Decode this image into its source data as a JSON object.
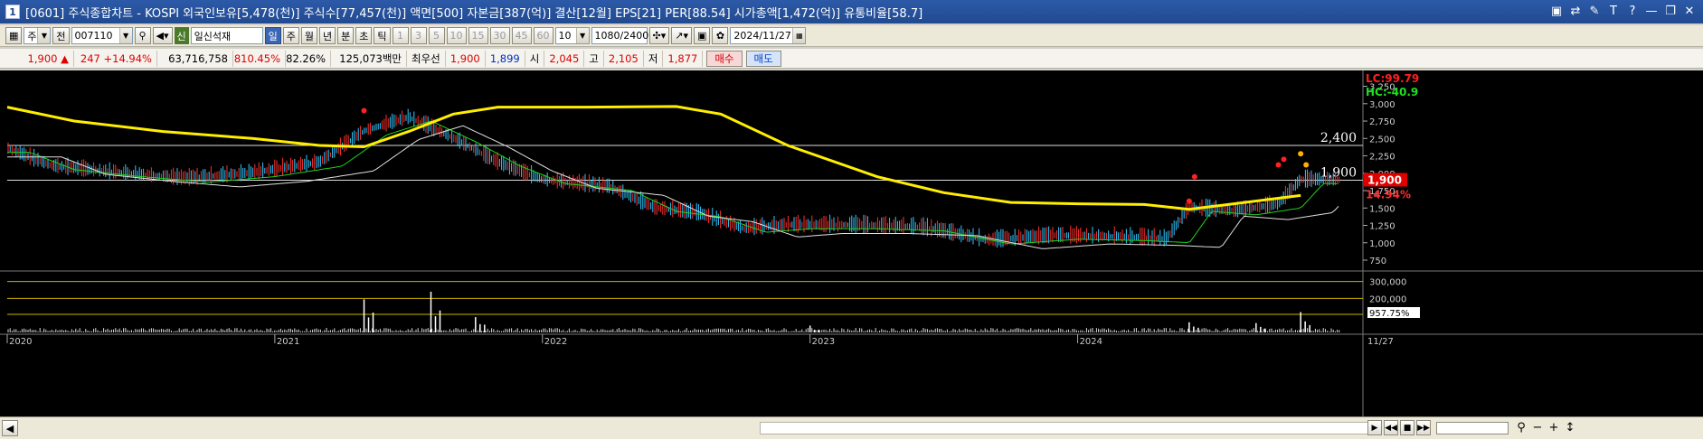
{
  "window": {
    "number": "1",
    "title": "[0601] 주식종합차트 - KOSPI 외국인보유[5,478(천)] 주식수[77,457(천)] 액면[500] 자본금[387(억)] 결산[12월] EPS[21] PER[88.54] 시가총액[1,472(억)] 유통비율[58.7]",
    "buttons": [
      "▣",
      "⇄",
      "✎",
      "T",
      "?",
      "—",
      "❐",
      "✕"
    ]
  },
  "toolbar": {
    "market_select": "주",
    "prev_label": "전",
    "code": "007110",
    "new_badge": "신",
    "stock_name": "일신석재",
    "period_buttons": [
      "일",
      "주",
      "월",
      "년",
      "분",
      "초",
      "틱"
    ],
    "active_period": "일",
    "minute_buttons": [
      "1",
      "3",
      "5",
      "10",
      "15",
      "30",
      "45",
      "60"
    ],
    "minute_value": "10",
    "count_ratio": "1080/2400",
    "date": "2024/11/27"
  },
  "quote": {
    "price": "1,900",
    "price_arrow": "▲",
    "change": "247",
    "change_pct": "+14.94%",
    "volume": "63,716,758",
    "volume_ratio": "810.45%",
    "turnover": "82.26%",
    "amount": "125,073백만",
    "ask_label": "최우선",
    "ask": "1,900",
    "bid": "1,899",
    "open_label": "시",
    "open": "2,045",
    "high_label": "고",
    "high": "2,105",
    "low_label": "저",
    "low": "1,877",
    "buy_label": "매수",
    "sell_label": "매도"
  },
  "chart_data": {
    "type": "candlestick",
    "price_axis": [
      "3,250",
      "3,000",
      "2,750",
      "2,500",
      "2,250",
      "2,000",
      "1,750",
      "1,500",
      "1,250",
      "1,000",
      "750"
    ],
    "price_axis_values": [
      3250,
      3000,
      2750,
      2500,
      2250,
      2000,
      1750,
      1500,
      1250,
      1000,
      750
    ],
    "price_range": [
      750,
      3400
    ],
    "lc_label": "LC:99.79",
    "hc_label": "HC:-40.9",
    "level_lines": [
      {
        "label": "2,400",
        "value": 2400
      },
      {
        "label": "1,900",
        "value": 1900
      }
    ],
    "current_price_tag": "1,900",
    "current_change_tag": "14.94%",
    "volume_axis": [
      "300,000",
      "200,000",
      "957.75%"
    ],
    "volume_axis_values": [
      300000,
      200000
    ],
    "x_axis": [
      "2020",
      "2021",
      "2022",
      "2023",
      "2024",
      "11/27"
    ],
    "x_axis_dates": [
      "2020-01",
      "2021-01",
      "2022-01",
      "2023-01",
      "2024-01"
    ],
    "long_ma_yellow": [
      [
        "2020-01",
        2950
      ],
      [
        "2020-04",
        2750
      ],
      [
        "2020-08",
        2600
      ],
      [
        "2020-12",
        2500
      ],
      [
        "2021-03",
        2400
      ],
      [
        "2021-05",
        2380
      ],
      [
        "2021-07",
        2600
      ],
      [
        "2021-09",
        2850
      ],
      [
        "2021-11",
        2950
      ],
      [
        "2022-03",
        2950
      ],
      [
        "2022-07",
        2960
      ],
      [
        "2022-09",
        2850
      ],
      [
        "2022-12",
        2400
      ],
      [
        "2023-04",
        1950
      ],
      [
        "2023-07",
        1720
      ],
      [
        "2023-10",
        1580
      ],
      [
        "2024-01",
        1560
      ],
      [
        "2024-04",
        1550
      ],
      [
        "2024-06",
        1480
      ],
      [
        "2024-08",
        1560
      ],
      [
        "2024-11",
        1680
      ]
    ],
    "price_trend": [
      [
        "2020-01",
        2350
      ],
      [
        "2020-03",
        2100
      ],
      [
        "2020-06",
        2000
      ],
      [
        "2020-09",
        1920
      ],
      [
        "2020-12",
        2000
      ],
      [
        "2021-03",
        2150
      ],
      [
        "2021-05",
        2600
      ],
      [
        "2021-07",
        2800
      ],
      [
        "2021-09",
        2500
      ],
      [
        "2021-11",
        2150
      ],
      [
        "2022-01",
        1900
      ],
      [
        "2022-04",
        1800
      ],
      [
        "2022-06",
        1500
      ],
      [
        "2022-08",
        1420
      ],
      [
        "2022-10",
        1200
      ],
      [
        "2022-12",
        1250
      ],
      [
        "2023-03",
        1250
      ],
      [
        "2023-06",
        1220
      ],
      [
        "2023-09",
        1030
      ],
      [
        "2023-12",
        1100
      ],
      [
        "2024-03",
        1080
      ],
      [
        "2024-05",
        1050
      ],
      [
        "2024-06",
        1500
      ],
      [
        "2024-08",
        1450
      ],
      [
        "2024-10",
        1550
      ],
      [
        "2024-11",
        1900
      ]
    ],
    "signals": [
      [
        "2021-05",
        2900
      ],
      [
        "2024-06",
        1950
      ],
      [
        "2024-06",
        1600
      ],
      [
        "2024-10",
        2200
      ],
      [
        "2024-10",
        2120
      ],
      [
        "2024-11",
        2120
      ],
      [
        "2024-11",
        2280
      ]
    ],
    "volume_spikes": [
      [
        "2021-05",
        195000
      ],
      [
        "2021-08",
        240000
      ],
      [
        "2021-10",
        90000
      ],
      [
        "2023-01",
        40000
      ],
      [
        "2024-06",
        60000
      ],
      [
        "2024-09",
        55000
      ],
      [
        "2024-11",
        120000
      ]
    ]
  }
}
